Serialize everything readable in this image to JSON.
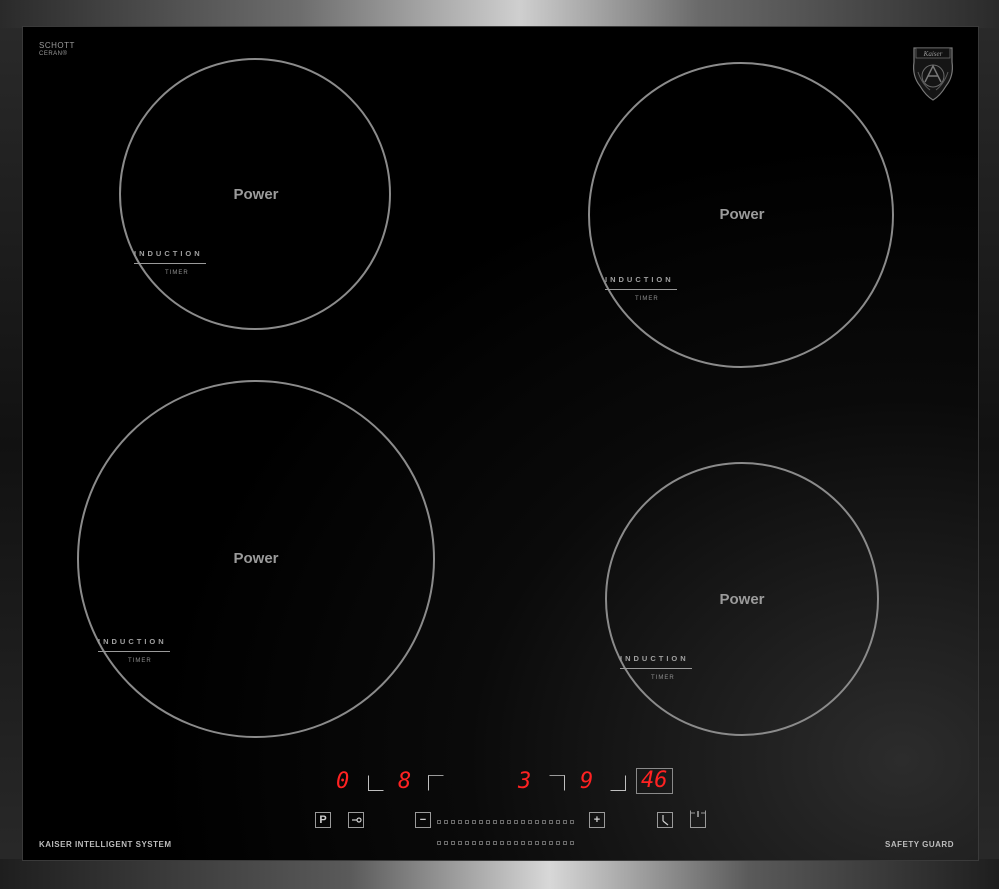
{
  "brand": {
    "schott_line1": "SCHOTT",
    "schott_line2": "CERAN®",
    "logo_text": "Kaiser"
  },
  "zones": [
    {
      "power": "Power",
      "induction": "INDUCTION",
      "timer": "TIMER"
    },
    {
      "power": "Power",
      "induction": "INDUCTION",
      "timer": "TIMER"
    },
    {
      "power": "Power",
      "induction": "INDUCTION",
      "timer": "TIMER"
    },
    {
      "power": "Power",
      "induction": "INDUCTION",
      "timer": "TIMER"
    }
  ],
  "display": {
    "d1": "0",
    "d2": "8",
    "d3": "3",
    "d4": "9",
    "timer": "46"
  },
  "controls": {
    "pause": "P",
    "minus": "−",
    "plus": "+"
  },
  "footer": {
    "left": "KAISER INTELLIGENT SYSTEM",
    "right": "SAFETY GUARD"
  },
  "colors": {
    "display": "#ff2222",
    "ring": "#8b8b8b",
    "glass": "#000000"
  }
}
